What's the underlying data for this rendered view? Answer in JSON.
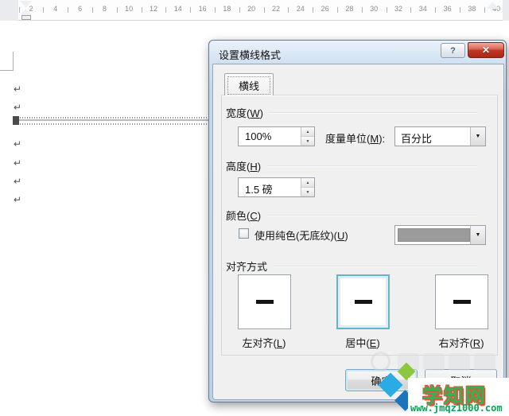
{
  "ruler": {
    "numbers": [
      "2",
      "4",
      "6",
      "8",
      "10",
      "12",
      "14",
      "16",
      "18",
      "20",
      "22",
      "24",
      "26",
      "28",
      "30",
      "32",
      "34",
      "36",
      "38",
      "40"
    ]
  },
  "document": {
    "paragraph_mark": "↵"
  },
  "icons": {
    "help": "?",
    "close": "✕",
    "spinner_up": "▲",
    "spinner_down": "▼",
    "dropdown_arrow": "▼"
  },
  "dialog": {
    "title": "设置横线格式",
    "tab_label": "横线",
    "width": {
      "label_pre": "宽度(",
      "label_key": "W",
      "label_post": ")",
      "value": "100%"
    },
    "unit": {
      "label_pre": "度量单位(",
      "label_key": "M",
      "label_post": "):",
      "value": "百分比"
    },
    "height": {
      "label_pre": "高度(",
      "label_key": "H",
      "label_post": ")",
      "value": "1.5 磅"
    },
    "color": {
      "label_pre": "颜色(",
      "label_key": "C",
      "label_post": ")",
      "checkbox_pre": "使用纯色(无底纹)(",
      "checkbox_key": "U",
      "checkbox_post": ")",
      "checkbox_checked": false,
      "swatch": "#9b9b9b"
    },
    "align": {
      "label": "对齐方式",
      "options": [
        {
          "pre": "左对齐(",
          "key": "L",
          "post": ")"
        },
        {
          "pre": "居中(",
          "key": "E",
          "post": ")"
        },
        {
          "pre": "右对齐(",
          "key": "R",
          "post": ")"
        }
      ],
      "selected_index": 1
    },
    "buttons": {
      "ok": "确定",
      "cancel": "取消"
    },
    "accent_close_red": "#c03a28",
    "accent_selected_teal": "#65b4c5"
  },
  "watermark": {
    "site": "学知网",
    "url": "www.jmqz1000.com",
    "site_green": "#2fb457",
    "outline_red": "#ea4f33",
    "url_green": "#00a651",
    "logo_colors": {
      "light_green": "#8dc63f",
      "cyan": "#2aabe3",
      "blue": "#1b75bc"
    }
  }
}
